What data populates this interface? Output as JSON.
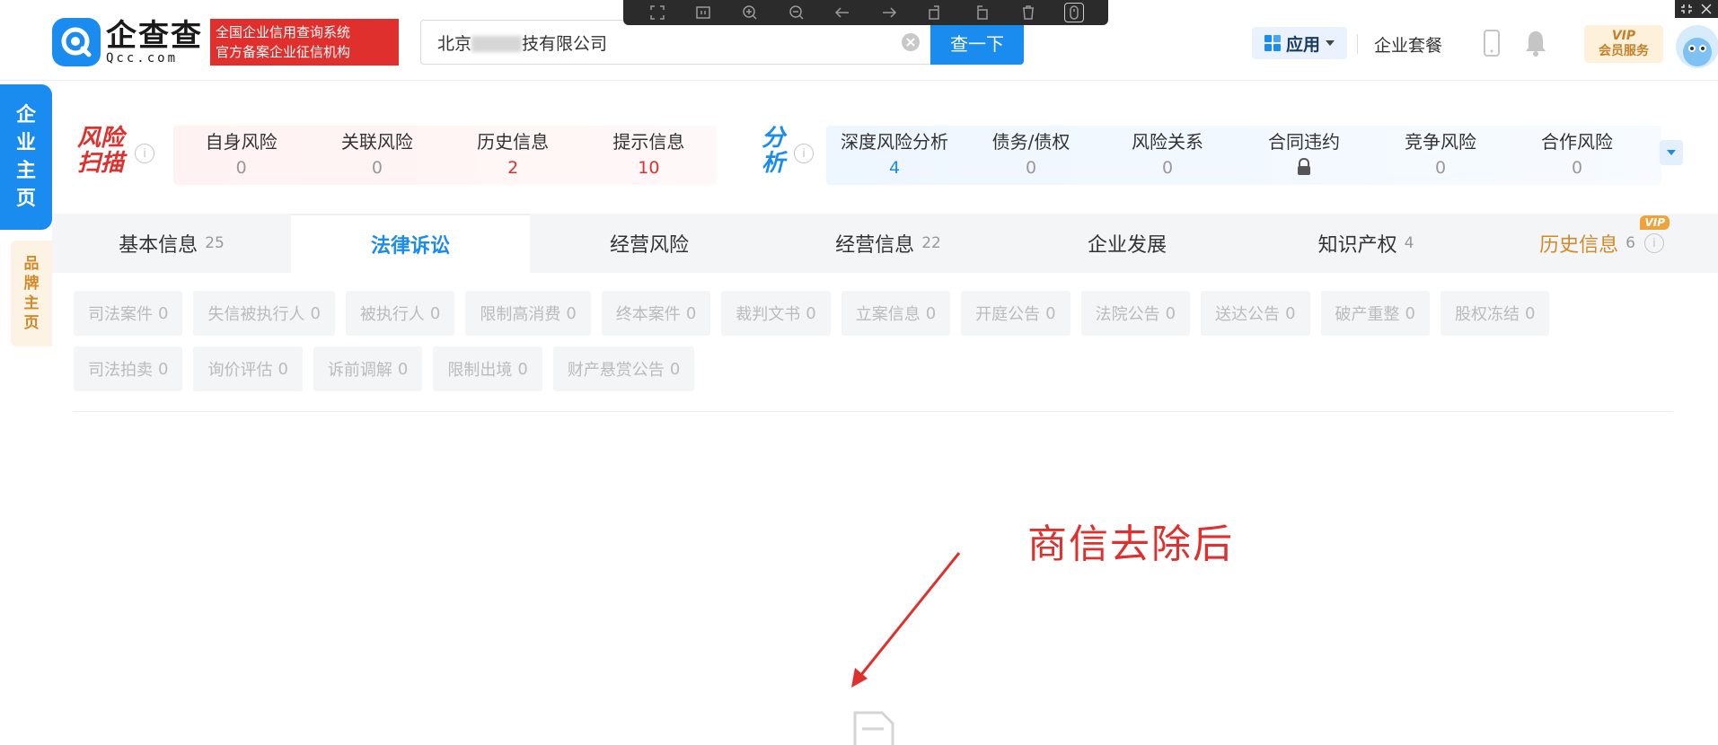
{
  "header": {
    "logo_name": "企查查",
    "logo_domain": "Qcc.com",
    "logo_badge_line1": "全国企业信用查询系统",
    "logo_badge_line2": "官方备案企业征信机构",
    "search_value_prefix": "北京",
    "search_value_suffix": "技有限公司",
    "search_button": "查一下",
    "apps_label": "应用",
    "package_label": "企业套餐",
    "vip_line1": "VIP",
    "vip_line2": "会员服务"
  },
  "side": {
    "main_tab": [
      "企",
      "业",
      "主",
      "页"
    ],
    "brand_tab": [
      "品",
      "牌",
      "主",
      "页"
    ]
  },
  "scan": {
    "risk_title_line1": "风险",
    "risk_title_line2": "扫描",
    "analysis_title_line1": "分",
    "analysis_title_line2": "析",
    "risk_items": [
      {
        "label": "自身风险",
        "value": "0"
      },
      {
        "label": "关联风险",
        "value": "0"
      },
      {
        "label": "历史信息",
        "value": "2"
      },
      {
        "label": "提示信息",
        "value": "10"
      }
    ],
    "analysis_items": [
      {
        "label": "深度风险分析",
        "value": "4"
      },
      {
        "label": "债务/债权",
        "value": "0"
      },
      {
        "label": "风险关系",
        "value": "0"
      },
      {
        "label": "合同违约",
        "value": ""
      },
      {
        "label": "竞争风险",
        "value": "0"
      },
      {
        "label": "合作风险",
        "value": "0"
      }
    ]
  },
  "tabs": [
    {
      "label": "基本信息",
      "count": "25"
    },
    {
      "label": "法律诉讼",
      "count": ""
    },
    {
      "label": "经营风险",
      "count": ""
    },
    {
      "label": "经营信息",
      "count": "22"
    },
    {
      "label": "企业发展",
      "count": ""
    },
    {
      "label": "知识产权",
      "count": "4"
    },
    {
      "label": "历史信息",
      "count": "6",
      "badge": "VIP"
    }
  ],
  "chips_row1": [
    {
      "label": "司法案件",
      "count": "0"
    },
    {
      "label": "失信被执行人",
      "count": "0"
    },
    {
      "label": "被执行人",
      "count": "0"
    },
    {
      "label": "限制高消费",
      "count": "0"
    },
    {
      "label": "终本案件",
      "count": "0"
    },
    {
      "label": "裁判文书",
      "count": "0"
    },
    {
      "label": "立案信息",
      "count": "0"
    },
    {
      "label": "开庭公告",
      "count": "0"
    },
    {
      "label": "法院公告",
      "count": "0"
    },
    {
      "label": "送达公告",
      "count": "0"
    },
    {
      "label": "破产重整",
      "count": "0"
    },
    {
      "label": "股权冻结",
      "count": "0"
    }
  ],
  "chips_row2": [
    {
      "label": "司法拍卖",
      "count": "0"
    },
    {
      "label": "询价评估",
      "count": "0"
    },
    {
      "label": "诉前调解",
      "count": "0"
    },
    {
      "label": "限制出境",
      "count": "0"
    },
    {
      "label": "财产悬赏公告",
      "count": "0"
    }
  ],
  "annotation": {
    "text": "商信去除后",
    "color": "#e0302d"
  },
  "colors": {
    "brand_blue": "#1a8cf0",
    "risk_red": "#e0302d",
    "vip_gold": "#d18a2a"
  }
}
